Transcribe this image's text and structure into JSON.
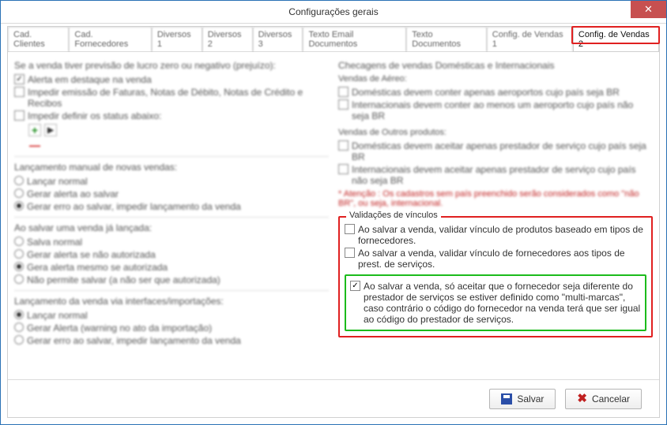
{
  "title": "Configurações gerais",
  "tabs": [
    "Cad. Clientes",
    "Cad. Fornecedores",
    "Diversos 1",
    "Diversos 2",
    "Diversos 3",
    "Texto Email Documentos",
    "Texto Documentos",
    "Config. de Vendas 1",
    "Config. de Vendas 2"
  ],
  "active_tab_index": 8,
  "left": {
    "zero_profit_header": "Se a venda tiver previsão de lucro zero ou negativo (prejuízo):",
    "cb_alerta_destaque": "Alerta em destaque na venda",
    "cb_impedir_emissao": "Impedir emissão de Faturas, Notas de Débito, Notas de Crédito e Recibos",
    "cb_impedir_status": "Impedir definir os status abaixo:",
    "group_novas_header": "Lançamento manual de novas vendas:",
    "novas_radios": [
      "Lançar normal",
      "Gerar alerta ao salvar",
      "Gerar erro ao salvar, impedir lançamento da venda"
    ],
    "novas_selected": 2,
    "group_salvar_header": "Ao salvar uma venda já lançada:",
    "salvar_radios": [
      "Salva normal",
      "Gerar alerta se não autorizada",
      "Gera alerta mesmo se autorizada",
      "Não permite salvar (a não ser que autorizada)"
    ],
    "salvar_selected": 2,
    "group_import_header": "Lançamento da venda via interfaces/importações:",
    "import_radios": [
      "Lançar normal",
      "Gerar Alerta (warning no ato da importação)",
      "Gerar erro ao salvar, impedir lançamento da venda"
    ],
    "import_selected": 0
  },
  "right": {
    "check_header": "Checagens de vendas Domésticas e Internacionais",
    "aereo_header": "Vendas de Aéreo:",
    "aereo_cb1": "Domésticas devem conter apenas aeroportos cujo país seja BR",
    "aereo_cb2": "Internacionais devem conter ao menos um aeroporto cujo país não seja BR",
    "outros_header": "Vendas de Outros produtos:",
    "outros_cb1": "Domésticas devem aceitar apenas prestador de serviço cujo país seja BR",
    "outros_cb2": "Internacionais devem aceitar apenas prestador de serviço cujo país não seja BR",
    "attention": "* Atenção : Os cadastros sem país preenchido serão considerados como \"não BR\", ou seja, internacional.",
    "valid_legend": "Validações de vínculos",
    "valid_cb1": "Ao salvar a venda, validar vínculo de produtos baseado em tipos de fornecedores.",
    "valid_cb2": "Ao salvar a venda, validar vínculo de fornecedores aos tipos de prest. de serviços.",
    "green_cb": "Ao salvar a venda, só aceitar que o fornecedor seja diferente do prestador de serviços se estiver definido como \"multi-marcas\", caso contrário o código do fornecedor na venda terá que ser igual ao código do prestador de serviços."
  },
  "footer": {
    "save": "Salvar",
    "cancel": "Cancelar"
  }
}
